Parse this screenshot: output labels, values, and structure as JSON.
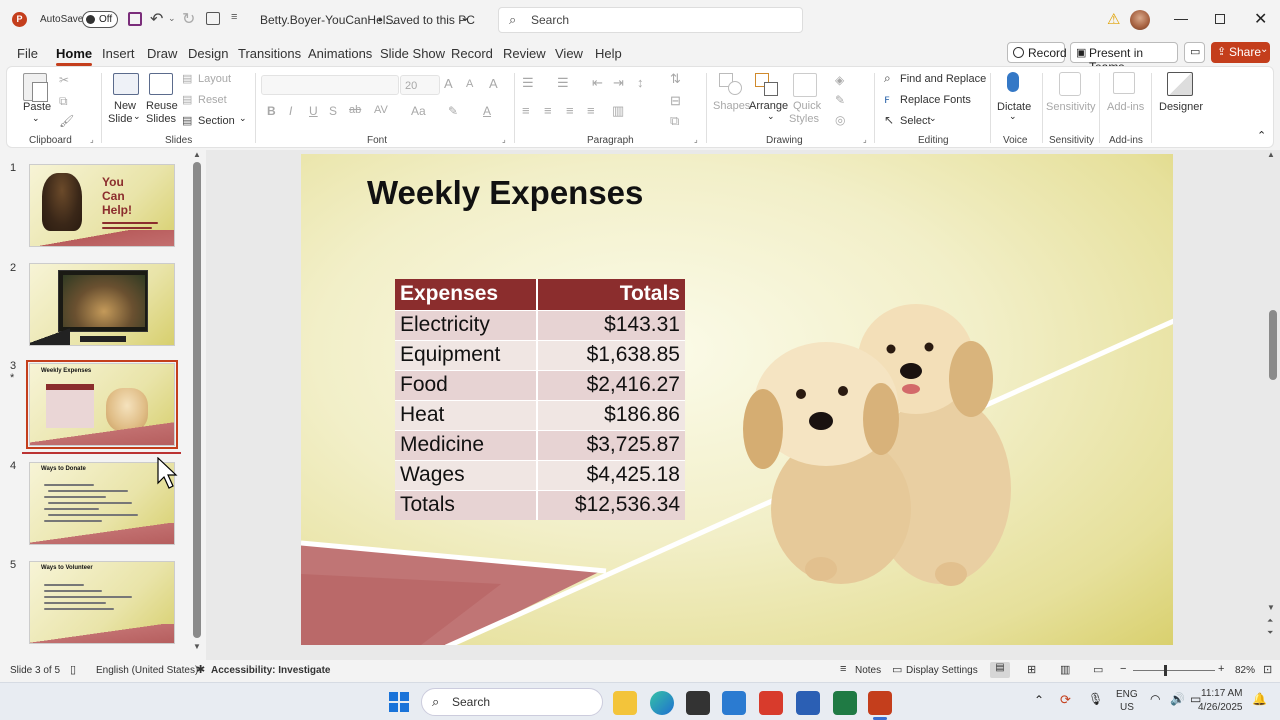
{
  "titlebar": {
    "autosave_label": "AutoSave",
    "autosave_state": "Off",
    "filename": "Betty.Boyer-YouCanHel...",
    "save_status": "• Saved to this PC",
    "search_placeholder": "Search"
  },
  "tabs": [
    "File",
    "Home",
    "Insert",
    "Draw",
    "Design",
    "Transitions",
    "Animations",
    "Slide Show",
    "Record",
    "Review",
    "View",
    "Help"
  ],
  "tab_buttons": {
    "record": "Record",
    "present": "Present in Teams",
    "share": "Share"
  },
  "ribbon": {
    "clipboard": {
      "paste": "Paste",
      "group": "Clipboard"
    },
    "slides": {
      "new_slide_1": "New",
      "new_slide_2": "Slide",
      "reuse_1": "Reuse",
      "reuse_2": "Slides",
      "layout": "Layout",
      "reset": "Reset",
      "section": "Section",
      "group": "Slides"
    },
    "font": {
      "font_size": "20",
      "group": "Font"
    },
    "paragraph": {
      "group": "Paragraph"
    },
    "drawing": {
      "shapes": "Shapes",
      "arrange": "Arrange",
      "quick_1": "Quick",
      "quick_2": "Styles",
      "group": "Drawing"
    },
    "editing": {
      "find": "Find and Replace",
      "replace_fonts": "Replace Fonts",
      "select": "Select",
      "group": "Editing"
    },
    "voice": {
      "dictate": "Dictate",
      "group": "Voice"
    },
    "sensitivity": {
      "label": "Sensitivity",
      "group": "Sensitivity"
    },
    "addins": {
      "label": "Add-ins",
      "group": "Add-ins"
    },
    "designer": {
      "label": "Designer"
    }
  },
  "thumbnails": [
    {
      "num": "1",
      "title_1": "You",
      "title_2": "Can",
      "title_3": "Help!"
    },
    {
      "num": "2"
    },
    {
      "num": "3",
      "star": "*",
      "title": "Weekly Expenses"
    },
    {
      "num": "4",
      "title": "Ways to Donate"
    },
    {
      "num": "5",
      "title": "Ways to Volunteer"
    }
  ],
  "slide": {
    "title": "Weekly Expenses",
    "table": {
      "headers": [
        "Expenses",
        "Totals"
      ],
      "rows": [
        [
          "Electricity",
          "$143.31"
        ],
        [
          "Equipment",
          "$1,638.85"
        ],
        [
          "Food",
          "$2,416.27"
        ],
        [
          "Heat",
          "$186.86"
        ],
        [
          "Medicine",
          "$3,725.87"
        ],
        [
          "Wages",
          "$4,425.18"
        ],
        [
          "Totals",
          "$12,536.34"
        ]
      ]
    }
  },
  "statusbar": {
    "slide_info": "Slide 3 of 5",
    "language": "English (United States)",
    "accessibility": "Accessibility: Investigate",
    "notes": "Notes",
    "display": "Display Settings",
    "zoom": "82%"
  },
  "taskbar": {
    "search": "Search",
    "lang_1": "ENG",
    "lang_2": "US",
    "time": "11:17 AM",
    "date": "4/26/2025"
  },
  "colors": {
    "accent": "#c43e1c",
    "table_header": "#8b2d2d"
  }
}
